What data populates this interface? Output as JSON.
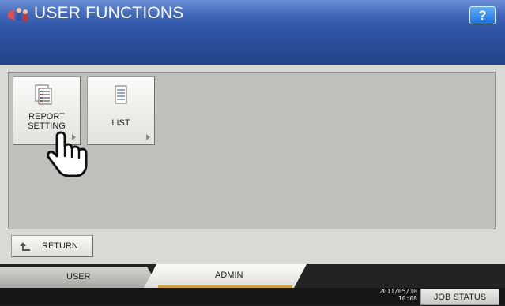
{
  "header": {
    "app_icon": "user-functions-icon",
    "title": "USER FUNCTIONS",
    "help_label": "?"
  },
  "functions": [
    {
      "label_line1": "REPORT",
      "label_line2": "SETTING",
      "icon": "report-setting-icon"
    },
    {
      "label_line1": "LIST",
      "label_line2": "",
      "icon": "list-icon"
    }
  ],
  "return": {
    "label": "RETURN",
    "icon": "return-arrow-icon"
  },
  "tabs": [
    {
      "label": "USER",
      "active": false
    },
    {
      "label": "ADMIN",
      "active": true
    }
  ],
  "status": {
    "date": "2011/05/10",
    "time": "10:08",
    "job_status_label": "JOB STATUS"
  },
  "colors": {
    "header": "#3f66b8",
    "band": "#2a4c98",
    "active_tab_accent": "#e0a020"
  }
}
